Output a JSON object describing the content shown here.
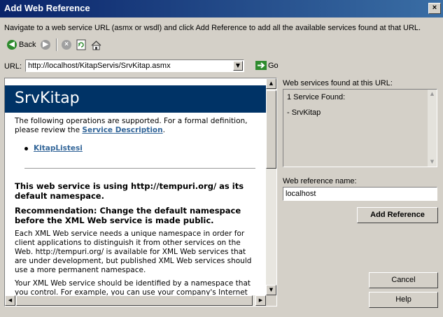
{
  "window": {
    "title": "Add Web Reference",
    "close_glyph": "×"
  },
  "instruction": "Navigate to a web service URL (asmx or wsdl) and click Add Reference to add all the available services found at that URL.",
  "toolbar": {
    "back_label": "Back"
  },
  "url": {
    "label": "URL:",
    "value": "http://localhost/KitapServis/SrvKitap.asmx",
    "go_label": "Go"
  },
  "page": {
    "title": "SrvKitap",
    "ops_text": "The following operations are supported. For a formal definition, please review the",
    "service_desc_link": "Service Description",
    "ops_end": ".",
    "operations": [
      "KitapListesi"
    ],
    "namespace_heading": "This web service is using http://tempuri.org/ as its default namespace.",
    "recommendation_heading": "Recommendation: Change the default namespace before the XML Web service is made public.",
    "para1": "Each XML Web service needs a unique namespace in order for client applications to distinguish it from other services on the Web. http://tempuri.org/ is available for XML Web services that are under development, but published XML Web services should use a more permanent namespace.",
    "para2": "Your XML Web service should be identified by a namespace that you control. For example, you can use your company's Internet"
  },
  "services": {
    "label": "Web services found at this URL:",
    "count_text": "1 Service Found:",
    "items": [
      "- SrvKitap"
    ]
  },
  "reference": {
    "label": "Web reference name:",
    "value": "localhost"
  },
  "buttons": {
    "add_reference": "Add Reference",
    "cancel": "Cancel",
    "help": "Help"
  },
  "colors": {
    "title_bar": "#0a246a",
    "banner": "#003366",
    "link": "#336699",
    "dialog": "#d4d0c8"
  }
}
